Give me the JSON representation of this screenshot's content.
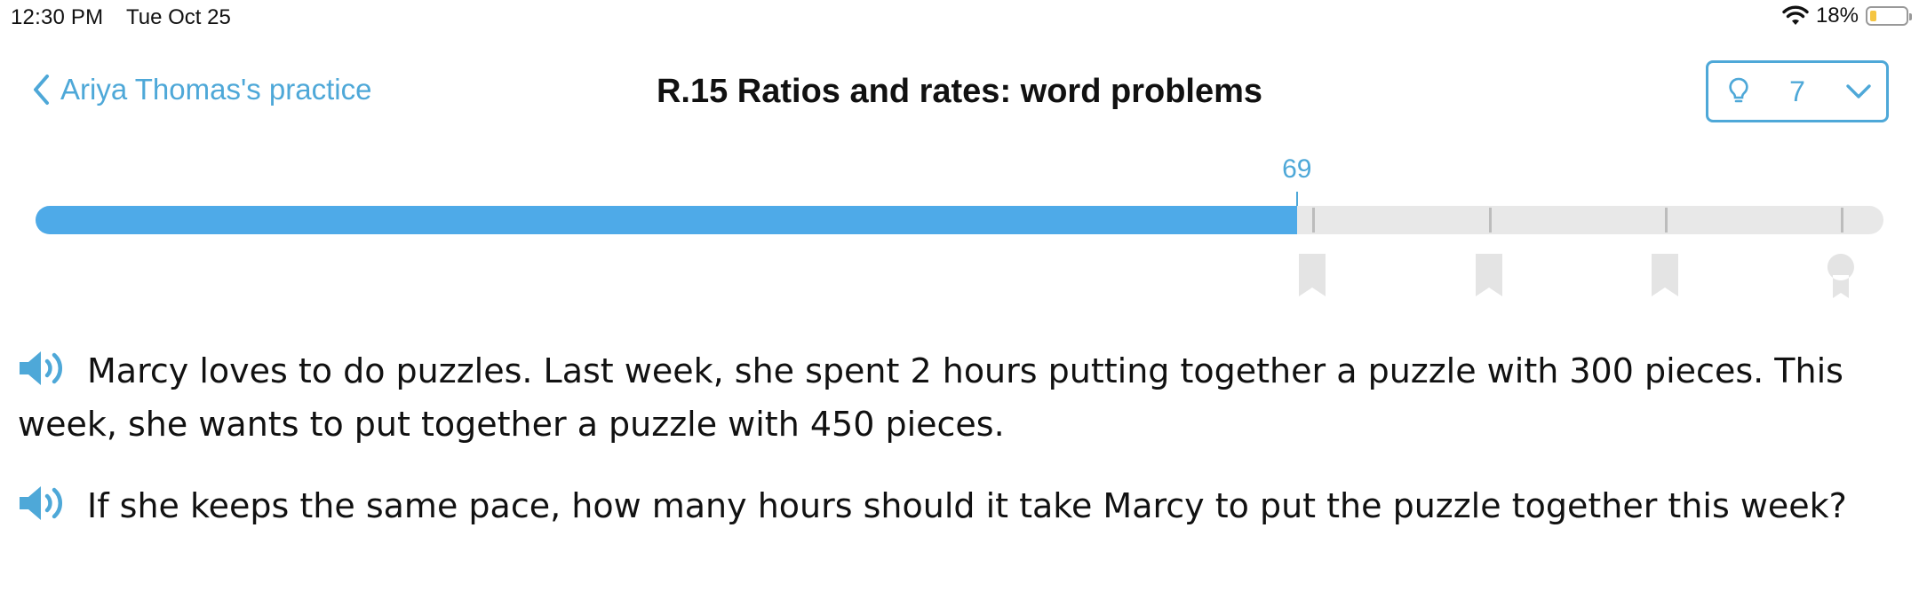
{
  "status_bar": {
    "time": "12:30 PM",
    "date": "Tue Oct 25",
    "battery_text": "18%",
    "battery_level": 0.18,
    "icons": [
      "wifi-icon",
      "battery-icon"
    ]
  },
  "header": {
    "back_label": "Ariya Thomas's practice",
    "title": "R.15 Ratios and rates: word problems",
    "hint_count": "7",
    "icons": [
      "chevron-left-icon",
      "lightbulb-icon",
      "chevron-down-icon"
    ]
  },
  "progress": {
    "score": "69",
    "score_value": 69,
    "max_value": 100,
    "milestones": [
      70,
      80,
      90,
      100
    ],
    "milestone_icons": [
      "bookmark-icon",
      "bookmark-icon",
      "bookmark-icon",
      "award-ribbon-icon"
    ]
  },
  "questions": [
    {
      "text": "Marcy loves to do puzzles. Last week, she spent 2 hours putting together a puzzle with 300 pieces. This week, she wants to put together a puzzle with 450 pieces."
    },
    {
      "text": "If she keeps the same pace, how many hours should it take Marcy to put the puzzle together this week?"
    }
  ],
  "colors": {
    "accent": "#4ea8d8",
    "progress_fill": "#4eaae8",
    "track": "#e8e8e8",
    "milestone": "#e4e4e4",
    "battery": "#f5c542"
  }
}
